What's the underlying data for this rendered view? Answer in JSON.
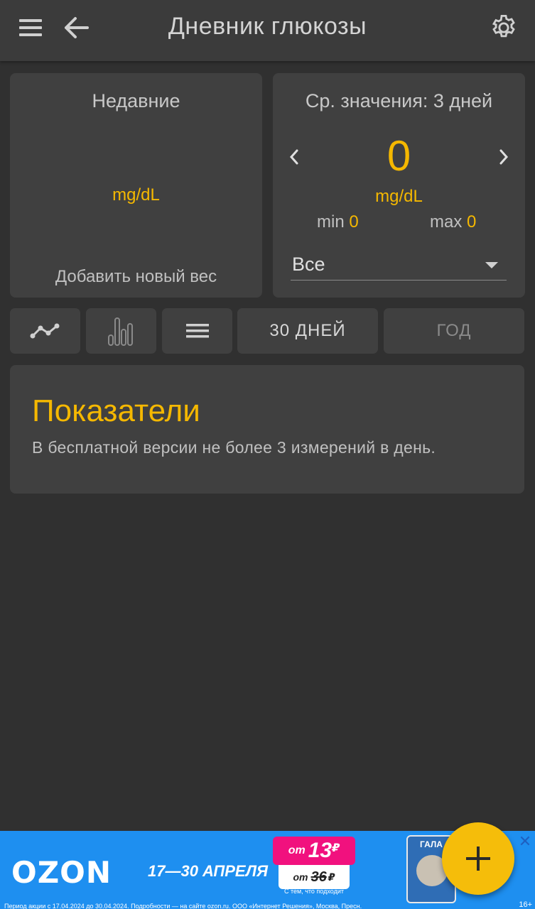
{
  "header": {
    "title": "Дневник глюкозы",
    "menu_icon": "menu-icon",
    "back_icon": "back-arrow-icon",
    "settings_icon": "gear-icon"
  },
  "recent_card": {
    "title": "Недавние",
    "unit": "mg/dL",
    "add_label": "Добавить новый вес"
  },
  "average_card": {
    "title": "Ср. значения: 3 дней",
    "value": "0",
    "unit": "mg/dL",
    "min_label": "min",
    "min_value": "0",
    "max_label": "max",
    "max_value": "0",
    "filter_value": "Все"
  },
  "view_buttons": {
    "line_chart_icon": "line-chart-icon",
    "bar_chart_icon": "bar-chart-icon",
    "list_icon": "list-icon",
    "range_30_label": "30 ДНЕЙ",
    "range_year_label": "ГОД"
  },
  "info_card": {
    "heading": "Показатели",
    "text": "В бесплатной версии не более 3 измерений в день."
  },
  "ad": {
    "brand": "OZON",
    "dates": "17—30 АПРЕЛЯ",
    "price_from": "от",
    "price": "13",
    "currency": "₽",
    "old_price_from": "от",
    "old_price": "36",
    "small_text": "С тем, что подходит",
    "product_label": "ГАЛА",
    "legal": "Период акции с 17.04.2024 до 30.04.2024. Подробности — на сайте ozon.ru. ООО «Интернет Решения», Москва, Пресн.",
    "age": "16+"
  },
  "fab": {
    "icon": "plus-icon"
  },
  "colors": {
    "background": "#303030",
    "card": "#404040",
    "appbar": "#3b3b3b",
    "accent": "#f5b800",
    "ad_background": "#1e8ff0"
  }
}
